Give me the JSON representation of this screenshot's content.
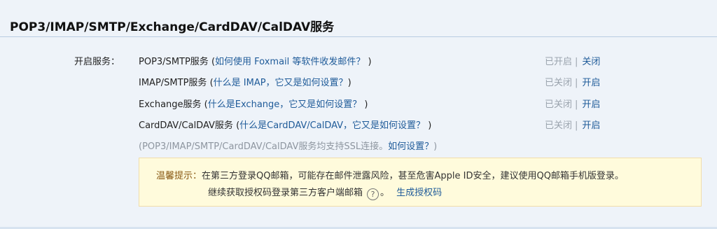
{
  "header": {
    "title": "POP3/IMAP/SMTP/Exchange/CardDAV/CalDAV服务"
  },
  "section_label": "开启服务：",
  "services": [
    {
      "name": "POP3/SMTP服务",
      "help": "如何使用 Foxmail 等软件收发邮件？",
      "state": "已开启",
      "action": "关闭"
    },
    {
      "name": "IMAP/SMTP服务",
      "help": "什么是 IMAP，它又是如何设置？",
      "state": "已关闭",
      "action": "开启"
    },
    {
      "name": "Exchange服务",
      "help": "什么是Exchange，它又是如何设置？",
      "state": "已关闭",
      "action": "开启"
    },
    {
      "name": "CardDAV/CalDAV服务",
      "help": "什么是CardDAV/CalDAV，它又是如何设置？",
      "state": "已关闭",
      "action": "开启"
    }
  ],
  "ssl_note": {
    "text": "(POP3/IMAP/SMTP/CardDAV/CalDAV服务均支持SSL连接。",
    "link": "如何设置？",
    "end": ")"
  },
  "tip": {
    "prefix": "温馨提示：",
    "message": "在第三方登录QQ邮箱，可能存在邮件泄露风险，甚至危害Apple ID安全，建议使用QQ邮箱手机版登录。",
    "line2": "继续获取授权码登录第三方客户端邮箱",
    "help_glyph": "?",
    "after_icon": "。",
    "generate_link": "生成授权码"
  },
  "colors": {
    "link": "#1f5b99",
    "muted": "#9aa3ad",
    "tip_bg": "#fffbdc",
    "tip_border": "#f1ddab",
    "page_bg": "#eef3f9"
  }
}
